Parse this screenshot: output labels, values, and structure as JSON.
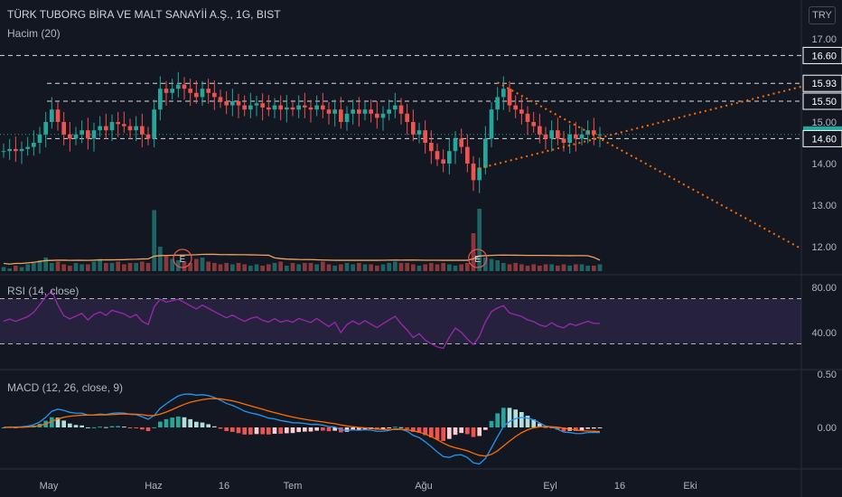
{
  "header": {
    "title": "TÜRK TUBORG BİRA VE MALT SANAYİİ A.Ş., 1G, BIST",
    "volume_label": "Hacim (20)",
    "currency": "TRY"
  },
  "indicators": {
    "rsi_label": "RSI (14, close)",
    "macd_label": "MACD (12, 26, close, 9)"
  },
  "colors": {
    "up": "#26a69a",
    "down": "#ef5350",
    "background": "#131722",
    "ma_volume": "#f0a35e",
    "rsi": "#9c27b0",
    "macd": "#2196f3",
    "signal": "#ff6d00",
    "trend": "#ff6d00"
  },
  "chart_data": [
    {
      "type": "candlestick",
      "name": "price",
      "ylim": [
        11.7,
        17.3
      ],
      "yticks": [
        "17.00",
        "16.00",
        "15.00",
        "14.00",
        "13.00",
        "12.00"
      ],
      "price_labels": [
        {
          "value": 16.6,
          "label": "16.60",
          "style": "outline"
        },
        {
          "value": 15.93,
          "label": "15.93",
          "style": "outline"
        },
        {
          "value": 15.5,
          "label": "15.50",
          "style": "outline"
        },
        {
          "value": 14.7,
          "label": "14.70",
          "style": "current"
        },
        {
          "value": 14.6,
          "label": "14.60",
          "style": "outline"
        }
      ],
      "horizontal_levels": [
        16.6,
        15.93,
        15.5,
        14.6
      ],
      "current_price": 14.7,
      "xticks": [
        "May",
        "Haz",
        "16",
        "Tem",
        "Ağu",
        "Eyl",
        "16",
        "Eki"
      ],
      "start_close": 14.3,
      "closes": [
        14.3,
        14.35,
        14.3,
        14.35,
        14.4,
        14.5,
        14.7,
        15.0,
        15.3,
        15.0,
        14.7,
        14.6,
        14.7,
        14.8,
        14.6,
        14.8,
        14.9,
        14.8,
        15.0,
        14.95,
        14.9,
        14.8,
        14.9,
        14.7,
        14.6,
        15.3,
        15.8,
        15.7,
        15.8,
        15.9,
        15.8,
        15.7,
        15.6,
        15.8,
        15.7,
        15.6,
        15.5,
        15.4,
        15.5,
        15.4,
        15.3,
        15.4,
        15.45,
        15.35,
        15.3,
        15.4,
        15.3,
        15.35,
        15.3,
        15.4,
        15.35,
        15.3,
        15.4,
        15.3,
        15.2,
        15.3,
        15.0,
        15.2,
        15.3,
        15.2,
        15.3,
        15.2,
        15.1,
        15.2,
        15.3,
        15.4,
        15.2,
        15.0,
        14.7,
        14.8,
        14.5,
        14.3,
        14.1,
        14.0,
        14.3,
        14.6,
        14.4,
        14.0,
        13.6,
        13.9,
        14.6,
        15.3,
        15.6,
        15.8,
        15.4,
        15.3,
        15.2,
        15.0,
        14.9,
        14.7,
        14.6,
        14.8,
        14.6,
        14.5,
        14.7,
        14.6,
        14.7,
        14.8,
        14.7,
        14.7
      ],
      "volumes": [
        0.3,
        0.2,
        0.4,
        0.3,
        0.5,
        0.6,
        0.8,
        1.0,
        0.6,
        0.7,
        0.5,
        0.4,
        0.6,
        0.5,
        0.5,
        0.7,
        0.9,
        0.6,
        0.6,
        0.7,
        0.5,
        0.6,
        0.6,
        0.7,
        0.6,
        4.5,
        1.8,
        1.1,
        0.9,
        0.8,
        0.7,
        0.6,
        0.9,
        1.0,
        0.7,
        0.6,
        0.5,
        0.6,
        0.5,
        0.6,
        0.5,
        0.4,
        0.5,
        0.4,
        0.5,
        0.6,
        0.7,
        0.4,
        0.6,
        0.5,
        0.6,
        0.6,
        0.5,
        0.7,
        0.5,
        0.4,
        0.5,
        0.6,
        0.5,
        0.6,
        0.5,
        0.5,
        0.4,
        0.5,
        0.6,
        0.7,
        0.6,
        0.6,
        0.5,
        0.4,
        0.5,
        0.6,
        0.5,
        0.6,
        0.5,
        0.4,
        0.5,
        0.6,
        2.8,
        4.6,
        1.0,
        0.9,
        0.8,
        0.6,
        0.5,
        0.6,
        0.5,
        0.4,
        0.5,
        0.4,
        0.5,
        0.5,
        0.4,
        0.5,
        0.4,
        0.5,
        0.5,
        0.4,
        0.4,
        0.5
      ],
      "earnings_markers": [
        {
          "index": 30,
          "label": "E"
        },
        {
          "index": 79,
          "label": "E"
        }
      ]
    },
    {
      "type": "line",
      "name": "RSI",
      "ylim": [
        20,
        90
      ],
      "yticks": [
        "80.00",
        "40.00"
      ],
      "bands": [
        70,
        30
      ]
    },
    {
      "type": "line",
      "name": "MACD",
      "ylim": [
        -0.45,
        0.6
      ],
      "yticks": [
        "0.50",
        "0.00"
      ]
    }
  ]
}
